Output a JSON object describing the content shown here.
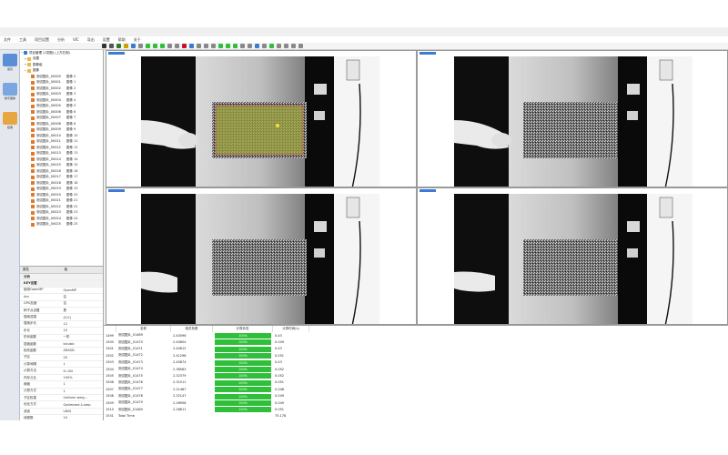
{
  "app": {
    "title": "XDIC",
    "accent": "#c8102e",
    "window_controls": [
      "—",
      "☐",
      "✕"
    ]
  },
  "menu": [
    "文件",
    "工具",
    "项目设置",
    "分析",
    "VIC",
    "导出",
    "设置",
    "帮助",
    "关于"
  ],
  "sidebar": [
    {
      "icon": "home-icon",
      "label": "首页",
      "color": "#5a8fd6"
    },
    {
      "icon": "analysis-icon",
      "label": "数字图像",
      "color": "#7aa7e0"
    },
    {
      "icon": "folder-icon",
      "label": "结果",
      "color": "#e8a640"
    }
  ],
  "tree": {
    "root": "项目管理 (1张图) (上方右侧)",
    "groups": [
      "设置",
      "图像组",
      "图像"
    ],
    "items": [
      {
        "name": "测试图片_00000",
        "idx": "图像 0"
      },
      {
        "name": "测试图片_00001",
        "idx": "图像 1"
      },
      {
        "name": "测试图片_00002",
        "idx": "图像 2"
      },
      {
        "name": "测试图片_00003",
        "idx": "图像 3"
      },
      {
        "name": "测试图片_00004",
        "idx": "图像 4"
      },
      {
        "name": "测试图片_00005",
        "idx": "图像 5"
      },
      {
        "name": "测试图片_00006",
        "idx": "图像 6"
      },
      {
        "name": "测试图片_00007",
        "idx": "图像 7"
      },
      {
        "name": "测试图片_00008",
        "idx": "图像 8"
      },
      {
        "name": "测试图片_00009",
        "idx": "图像 9"
      },
      {
        "name": "测试图片_00010",
        "idx": "图像 10"
      },
      {
        "name": "测试图片_00011",
        "idx": "图像 11"
      },
      {
        "name": "测试图片_00012",
        "idx": "图像 12"
      },
      {
        "name": "测试图片_00013",
        "idx": "图像 13"
      },
      {
        "name": "测试图片_00014",
        "idx": "图像 14"
      },
      {
        "name": "测试图片_00015",
        "idx": "图像 15"
      },
      {
        "name": "测试图片_00016",
        "idx": "图像 16"
      },
      {
        "name": "测试图片_00017",
        "idx": "图像 17"
      },
      {
        "name": "测试图片_00018",
        "idx": "图像 18"
      },
      {
        "name": "测试图片_00019",
        "idx": "图像 19"
      },
      {
        "name": "测试图片_00020",
        "idx": "图像 20"
      },
      {
        "name": "测试图片_00021",
        "idx": "图像 21"
      },
      {
        "name": "测试图片_00022",
        "idx": "图像 22"
      },
      {
        "name": "测试图片_00023",
        "idx": "图像 23"
      },
      {
        "name": "测试图片_00024",
        "idx": "图像 24"
      },
      {
        "name": "测试图片_00025",
        "idx": "图像 25"
      }
    ]
  },
  "properties": {
    "headers": [
      "属性",
      "值"
    ],
    "rows": [
      {
        "k": "分析",
        "v": "",
        "cat": true
      },
      {
        "k": "KEY设置",
        "v": "",
        "cat": true
      },
      {
        "k": "使用OpenMP",
        "v": "OpenMP"
      },
      {
        "k": "Acc",
        "v": "否"
      },
      {
        "k": "GPU加速",
        "v": "否"
      },
      {
        "k": "种子点设置",
        "v": "是"
      },
      {
        "k": "搜索范围",
        "v": "(0,0)"
      },
      {
        "k": "搜索步长",
        "v": "12"
      },
      {
        "k": "步长",
        "v": "10"
      },
      {
        "k": "形状函数",
        "v": "一阶"
      },
      {
        "k": "插值函数",
        "v": "bicubic"
      },
      {
        "k": "相关函数",
        "v": "ZNSSD"
      },
      {
        "k": "子区",
        "v": "29"
      },
      {
        "k": "计算间隔",
        "v": "1"
      },
      {
        "k": "计算方法",
        "v": "IC-GN"
      },
      {
        "k": "内存占比",
        "v": "100%"
      },
      {
        "k": "阈值",
        "v": "1"
      },
      {
        "k": "计算方式",
        "v": "1"
      },
      {
        "k": "子区权重",
        "v": "Uniform weig..."
      },
      {
        "k": "优化方式",
        "v": "Optimized 4-step"
      },
      {
        "k": "滤波",
        "v": "LBVS"
      },
      {
        "k": "线程数",
        "v": "24"
      },
      {
        "k": "CPU核数",
        "v": "24"
      },
      {
        "k": "缓存大小",
        "v": "4.00 GB"
      }
    ]
  },
  "toolbar_colors": [
    "#333",
    "#555",
    "#2a7d2a",
    "#c8a000",
    "#3a7bd5",
    "#888",
    "#2fbf3a",
    "#2fbf3a",
    "#2fbf3a",
    "#888",
    "#888",
    "#c8102e",
    "#3a7bd5",
    "#888",
    "#888",
    "#888",
    "#2fbf3a",
    "#2fbf3a",
    "#2fbf3a",
    "#888",
    "#888",
    "#3a7bd5",
    "#888",
    "#2fbf3a",
    "#888",
    "#888",
    "#888",
    "#888"
  ],
  "table": {
    "headers": [
      "",
      "名称",
      "相关系数",
      "计算状态",
      "计算时间(s)"
    ],
    "rows": [
      {
        "id": "1499",
        "name": "测试图片_01469",
        "cc": "2.40596",
        "status": "100%",
        "time": "0.43"
      },
      {
        "id": "1500",
        "name": "测试图片_01470",
        "cc": "2.40604",
        "status": "100%",
        "time": "0.049"
      },
      {
        "id": "1501",
        "name": "测试图片_01471",
        "cc": "2.40612",
        "status": "100%",
        "time": "0.43"
      },
      {
        "id": "1502",
        "name": "测试图片_01472",
        "cc": "2.41298",
        "status": "100%",
        "time": "0.051"
      },
      {
        "id": "1503",
        "name": "测试图片_01473",
        "cc": "2.40874",
        "status": "100%",
        "time": "0.43"
      },
      {
        "id": "1504",
        "name": "测试图片_01474",
        "cc": "2.38583",
        "status": "100%",
        "time": "0.052"
      },
      {
        "id": "1505",
        "name": "测试图片_01475",
        "cc": "2.32379",
        "status": "100%",
        "time": "0.052"
      },
      {
        "id": "1506",
        "name": "测试图片_01476",
        "cc": "2.31511",
        "status": "100%",
        "time": "0.051"
      },
      {
        "id": "1507",
        "name": "测试图片_01477",
        "cc": "2.21487",
        "status": "100%",
        "time": "0.048"
      },
      {
        "id": "1508",
        "name": "测试图片_01478",
        "cc": "2.32147",
        "status": "100%",
        "time": "0.049"
      },
      {
        "id": "1509",
        "name": "测试图片_01479",
        "cc": "2.28958",
        "status": "100%",
        "time": "0.049"
      },
      {
        "id": "1510",
        "name": "测试图片_01480",
        "cc": "2.26611",
        "status": "100%",
        "time": "0.051"
      },
      {
        "id": "1531",
        "name": "Total Time",
        "cc": "",
        "status": "",
        "time": "75.178"
      }
    ]
  }
}
